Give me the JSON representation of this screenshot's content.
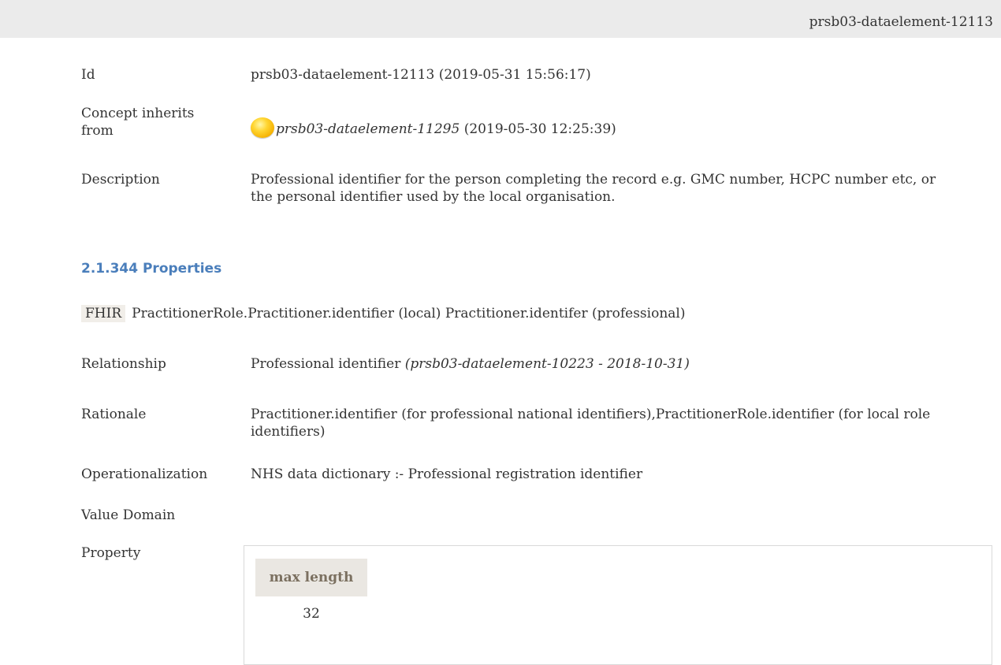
{
  "header": {
    "element_id": "prsb03-dataelement-12113"
  },
  "details": {
    "id_label": "Id",
    "id_value": "prsb03-dataelement-12113 (2019-05-31 15:56:17)",
    "inherits_label_line1": "Concept inherits",
    "inherits_label_line2": "from",
    "inherits_ref": "prsb03-dataelement-11295",
    "inherits_date": "(2019-05-30 12:25:39)",
    "description_label": "Description",
    "description_value": "Professional identifier for the person completing the record e.g. GMC number, HCPC number etc, or the personal identifier used by the local organisation."
  },
  "properties": {
    "heading": "2.1.344 Properties",
    "fhir_tag": "FHIR",
    "fhir_value": "PractitionerRole.Practitioner.identifier (local) Practitioner.identifer (professional)",
    "relationship_label": "Relationship",
    "relationship_value": "Professional identifier",
    "relationship_ref": "(prsb03-dataelement-10223 - 2018-10-31)",
    "rationale_label": "Rationale",
    "rationale_value": "Practitioner.identifier (for professional national identifiers),PractitionerRole.identifier (for local role identifiers)",
    "operationalization_label": "Operationalization",
    "operationalization_value": "NHS data dictionary :- Professional registration identifier",
    "value_domain_label": "Value Domain",
    "property_label": "Property",
    "property_table": {
      "header": "max length",
      "value": "32"
    }
  }
}
